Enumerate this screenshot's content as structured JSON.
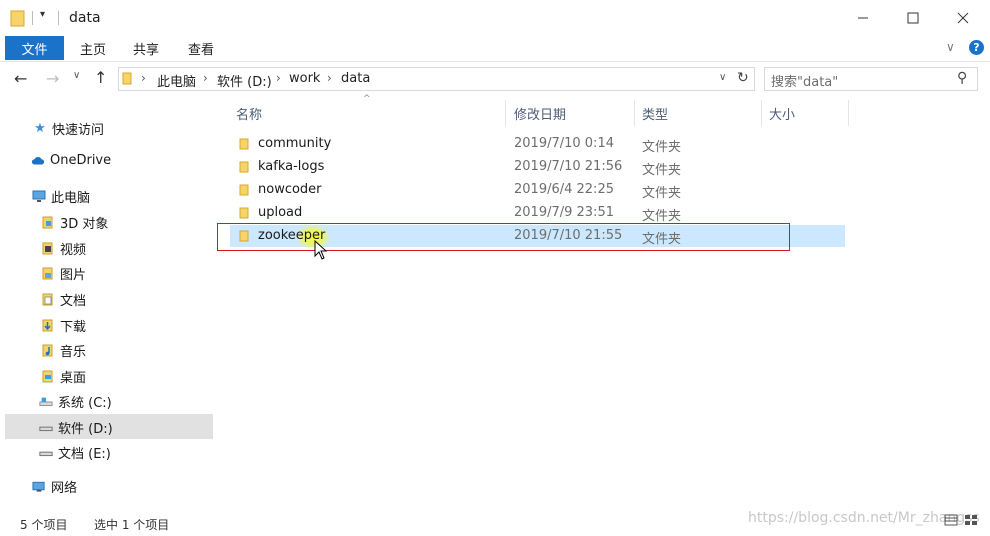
{
  "window": {
    "title": "data"
  },
  "ribbon": {
    "tabs": [
      "文件",
      "主页",
      "共享",
      "查看"
    ],
    "accent": "#1a73c8"
  },
  "address": {
    "crumbs": [
      "此电脑",
      "软件 (D:)",
      "work",
      "data"
    ]
  },
  "search": {
    "placeholder": "搜索\"data\""
  },
  "sidebar": {
    "items": [
      {
        "label": "快速访问",
        "icon": "star-icon"
      },
      {
        "label": "OneDrive",
        "icon": "cloud-icon"
      },
      {
        "label": "此电脑",
        "icon": "computer-icon"
      },
      {
        "label": "3D 对象",
        "icon": "cube-icon"
      },
      {
        "label": "视频",
        "icon": "video-icon"
      },
      {
        "label": "图片",
        "icon": "picture-icon"
      },
      {
        "label": "文档",
        "icon": "document-icon"
      },
      {
        "label": "下载",
        "icon": "download-icon"
      },
      {
        "label": "音乐",
        "icon": "music-icon"
      },
      {
        "label": "桌面",
        "icon": "desktop-icon"
      },
      {
        "label": "系统 (C:)",
        "icon": "drive-icon"
      },
      {
        "label": "软件 (D:)",
        "icon": "drive-icon",
        "selected": true
      },
      {
        "label": "文档 (E:)",
        "icon": "drive-icon"
      },
      {
        "label": "网络",
        "icon": "network-icon"
      }
    ]
  },
  "columns": {
    "name": "名称",
    "date": "修改日期",
    "type": "类型",
    "size": "大小"
  },
  "files": [
    {
      "name": "community",
      "date": "2019/7/10 0:14",
      "type": "文件夹"
    },
    {
      "name": "kafka-logs",
      "date": "2019/7/10 21:56",
      "type": "文件夹"
    },
    {
      "name": "nowcoder",
      "date": "2019/6/4 22:25",
      "type": "文件夹"
    },
    {
      "name": "upload",
      "date": "2019/7/9 23:51",
      "type": "文件夹"
    },
    {
      "name": "zookeeper",
      "date": "2019/7/10 21:55",
      "type": "文件夹",
      "selected": true
    }
  ],
  "status": {
    "count": "5 个项目",
    "selection": "选中 1 个项目"
  },
  "watermark": "https://blog.csdn.net/Mr_zhangss"
}
